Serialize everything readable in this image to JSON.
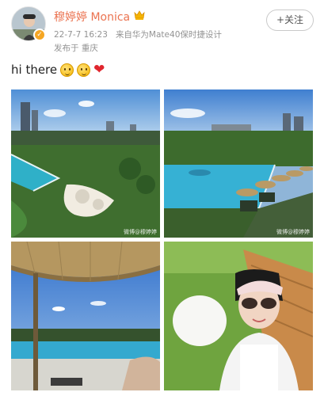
{
  "author": {
    "name": "穆婷婷 Monica",
    "avatar_icon": "profile-photo",
    "verified_icon": "verified-badge-icon",
    "crown_icon": "crown-icon"
  },
  "meta": {
    "date": "22-7-7 16:23",
    "source": "来自华为Mate40保时捷设计",
    "location": "发布于 重庆"
  },
  "actions": {
    "follow_label": "+关注"
  },
  "post": {
    "text": "hi there",
    "emojis": [
      "wink-face-icon",
      "wink-face-icon",
      "heart-icon"
    ]
  },
  "photos": [
    {
      "scene": "infinity-pool-aerial",
      "watermark": "微博@穆婷婷"
    },
    {
      "scene": "pool-with-umbrellas",
      "watermark": "微博@穆婷婷"
    },
    {
      "scene": "straw-umbrella-pool-view",
      "watermark": ""
    },
    {
      "scene": "selfie-with-visor",
      "watermark": ""
    }
  ],
  "colors": {
    "username": "#eb7350",
    "meta": "#939393",
    "heart": "#e0262e"
  }
}
